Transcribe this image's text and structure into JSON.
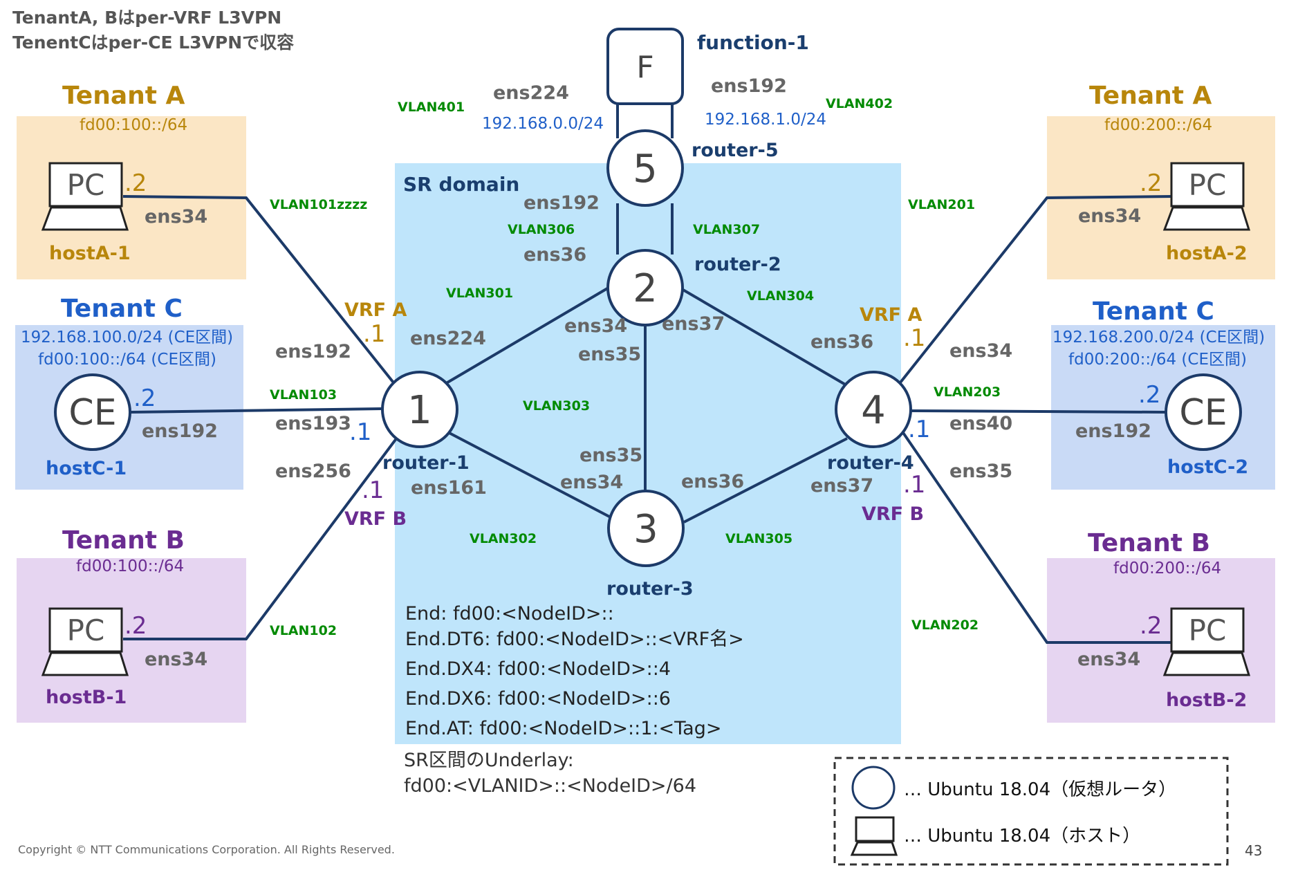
{
  "title": {
    "line1": "TenantA, Bはper-VRF L3VPN",
    "line2": "TenentCはper-CE L3VPNで収容"
  },
  "colors": {
    "tenant_a": "#b8860b",
    "tenant_a_bg": "#fbe6c5",
    "tenant_b": "#6a2c91",
    "tenant_b_bg": "#e6d5f1",
    "tenant_c": "#1f5fc8",
    "tenant_c_bg": "#c9daf6",
    "sr_domain_bg": "#bfe5fb",
    "link": "#1c3a68",
    "vlan": "#008a00",
    "subnet_blue": "#1f5fc8"
  },
  "sr_domain": {
    "label": "SR domain"
  },
  "tenants": {
    "a_left": {
      "name": "Tenant A",
      "subnet": "fd00:100::/64"
    },
    "a_right": {
      "name": "Tenant A",
      "subnet": "fd00:200::/64"
    },
    "b_left": {
      "name": "Tenant B",
      "subnet": "fd00:100::/64"
    },
    "b_right": {
      "name": "Tenant B",
      "subnet": "fd00:200::/64"
    },
    "c_left": {
      "name": "Tenant C",
      "subnet1": "192.168.100.0/24 (CE区間)",
      "subnet2": "fd00:100::/64 (CE区間)"
    },
    "c_right": {
      "name": "Tenant C",
      "subnet1": "192.168.200.0/24 (CE区間)",
      "subnet2": "fd00:200::/64 (CE区間)"
    }
  },
  "hosts": {
    "hostA1": {
      "name": "hostA-1",
      "icon": "PC",
      "addr": ".2",
      "iface": "ens34"
    },
    "hostA2": {
      "name": "hostA-2",
      "icon": "PC",
      "addr": ".2",
      "iface": "ens34"
    },
    "hostB1": {
      "name": "hostB-1",
      "icon": "PC",
      "addr": ".2",
      "iface": "ens34"
    },
    "hostB2": {
      "name": "hostB-2",
      "icon": "PC",
      "addr": ".2",
      "iface": "ens34"
    },
    "hostC1": {
      "name": "hostC-1",
      "icon": "CE",
      "addr": ".2",
      "iface": "ens192"
    },
    "hostC2": {
      "name": "hostC-2",
      "icon": "CE",
      "addr": ".2",
      "iface": "ens192"
    }
  },
  "routers": {
    "r1": {
      "id": "1",
      "name": "router-1"
    },
    "r2": {
      "id": "2",
      "name": "router-2"
    },
    "r3": {
      "id": "3",
      "name": "router-3"
    },
    "r4": {
      "id": "4",
      "name": "router-4"
    },
    "r5": {
      "id": "5",
      "name": "router-5"
    }
  },
  "function": {
    "id": "F",
    "name": "function-1",
    "if_left": "ens224",
    "if_right": "ens192",
    "net_left": "192.168.0.0/24",
    "net_right": "192.168.1.0/24",
    "vlan_left": "VLAN401",
    "vlan_right": "VLAN402"
  },
  "vlans": {
    "v101": "VLAN101zzzz",
    "v102": "VLAN102",
    "v103": "VLAN103",
    "v201": "VLAN201",
    "v202": "VLAN202",
    "v203": "VLAN203",
    "v301": "VLAN301",
    "v302": "VLAN302",
    "v303": "VLAN303",
    "v304": "VLAN304",
    "v305": "VLAN305",
    "v306": "VLAN306",
    "v307": "VLAN307"
  },
  "interfaces": {
    "r1_ens192": "ens192",
    "r1_ens193": "ens193",
    "r1_ens256": "ens256",
    "r1_ens224": "ens224",
    "r1_ens161": "ens161",
    "r2_ens192": "ens192",
    "r2_ens36": "ens36",
    "r2_ens34": "ens34",
    "r2_ens35": "ens35",
    "r2_ens37": "ens37",
    "r3_ens35": "ens35",
    "r3_ens34": "ens34",
    "r3_ens36": "ens36",
    "r4_ens36": "ens36",
    "r4_ens37": "ens37",
    "r4_ens34": "ens34",
    "r4_ens40": "ens40",
    "r4_ens35": "ens35"
  },
  "addresses": {
    "r1_vrfa": ".1",
    "r1_c": ".1",
    "r1_vrfb": ".1",
    "r4_vrfa": ".1",
    "r4_c": ".1",
    "r4_vrfb": ".1"
  },
  "vrf": {
    "r1_a": "VRF A",
    "r1_b": "VRF B",
    "r4_a": "VRF A",
    "r4_b": "VRF B"
  },
  "sids": [
    "End: fd00:<NodeID>::",
    "End.DT6: fd00:<NodeID>::<VRF名>",
    "End.DX4: fd00:<NodeID>::4",
    "End.DX6: fd00:<NodeID>::6",
    "End.AT: fd00:<NodeID>::1:<Tag>"
  ],
  "underlay": {
    "line1": "SR区間のUnderlay:",
    "line2": "fd00:<VLANID>::<NodeID>/64"
  },
  "legend": {
    "router": "… Ubuntu 18.04（仮想ルータ）",
    "host": "… Ubuntu 18.04（ホスト）"
  },
  "footer": {
    "copyright": "Copyright © NTT Communications Corporation. All Rights Reserved.",
    "page": "43"
  }
}
